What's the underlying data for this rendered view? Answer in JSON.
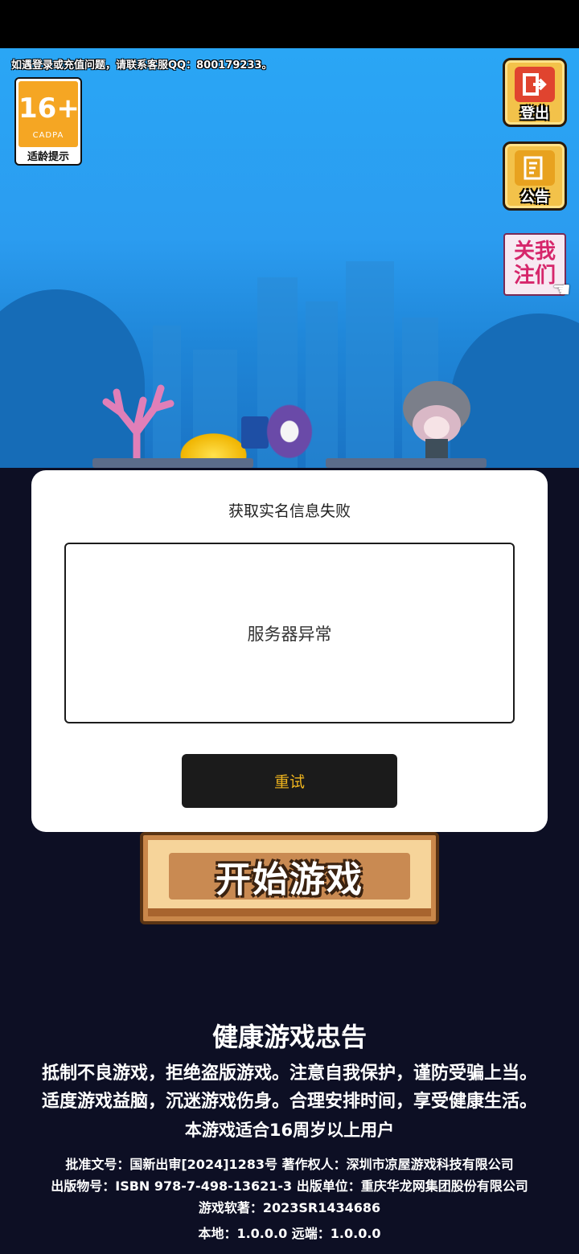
{
  "top_notice": "如遇登录或充值问题，请联系客服QQ：800179233。",
  "age_badge": {
    "age": "16+",
    "org": "CADPA",
    "hint": "适龄提示"
  },
  "side_buttons": [
    {
      "icon": "logout-icon",
      "label": "登出",
      "color": "#e0442f"
    },
    {
      "icon": "announcement-icon",
      "label": "公告",
      "color": "#e8a21f"
    }
  ],
  "follow_us": {
    "line1": "关我",
    "line2": "注们"
  },
  "dialog": {
    "title": "获取实名信息失败",
    "message": "服务器异常",
    "retry_label": "重试"
  },
  "start_button": {
    "label": "开始游戏"
  },
  "health_advice": {
    "title": "健康游戏忠告",
    "lines": [
      "抵制不良游戏，拒绝盗版游戏。注意自我保护，谨防受骗上当。",
      "适度游戏益脑，沉迷游戏伤身。合理安排时间，享受健康生活。",
      "本游戏适合16周岁以上用户"
    ]
  },
  "publication": {
    "lines": [
      "批准文号：国新出审[2024]1283号  著作权人：深圳市凉屋游戏科技有限公司",
      "出版物号：ISBN 978-7-498-13621-3  出版单位：重庆华龙网集团股份有限公司",
      "游戏软著：2023SR1434686"
    ],
    "version": "本地：1.0.0.0 远端：1.0.0.0"
  }
}
